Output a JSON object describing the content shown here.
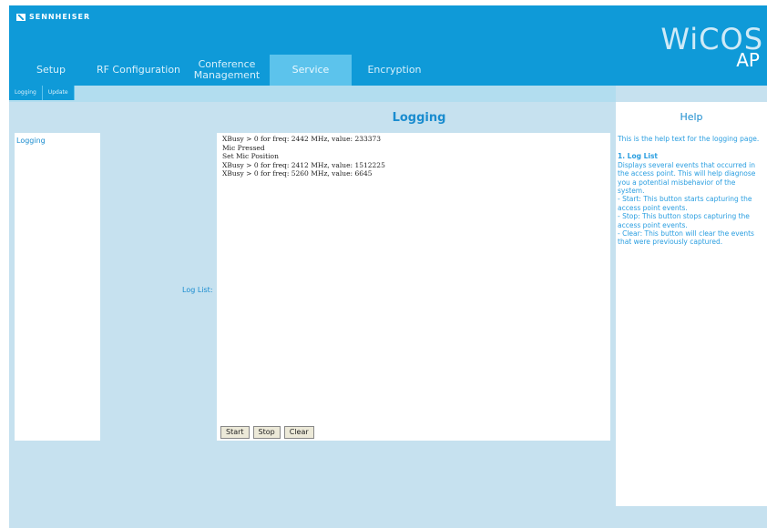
{
  "header": {
    "logo_text": "SENNHEISER",
    "brand_main": "WiCOS",
    "brand_sub": "AP",
    "nav": [
      {
        "label": "Setup"
      },
      {
        "label": "RF Configuration"
      },
      {
        "label": "Conference Management"
      },
      {
        "label": "Service",
        "active": true
      },
      {
        "label": "Encryption"
      }
    ]
  },
  "subnav": {
    "tabs": [
      {
        "label": "Logging"
      },
      {
        "label": "Update"
      }
    ]
  },
  "left_menu": {
    "items": [
      {
        "label": "Logging"
      }
    ]
  },
  "main": {
    "title": "Logging",
    "log_list_label": "Log List:",
    "log_lines": [
      "XBusy > 0 for freq: 2442 MHz, value: 233373",
      "Mic Pressed",
      "Set Mic Position",
      "XBusy > 0 for freq: 2412 MHz, value: 1512225",
      "XBusy > 0 for freq: 5260 MHz, value: 6645"
    ],
    "buttons": {
      "start": "Start",
      "stop": "Stop",
      "clear": "Clear"
    }
  },
  "help": {
    "title": "Help",
    "intro": "This is the help text for the logging page.",
    "section_title": "1. Log List",
    "section_text": "Displays several events that occurred in the access point. This will help diagnose you a potential misbehavior of the system.",
    "bullet_start": "- Start: This button starts capturing the access point events.",
    "bullet_stop": "- Stop: This button stops capturing the access point events.",
    "bullet_clear": "- Clear: This button will clear the events that were previously captured."
  },
  "colors": {
    "header_blue": "#0f9ad8",
    "active_tab": "#5cc3ec",
    "panel_bg": "#c6e1ef",
    "link_blue": "#1a8ccf"
  }
}
